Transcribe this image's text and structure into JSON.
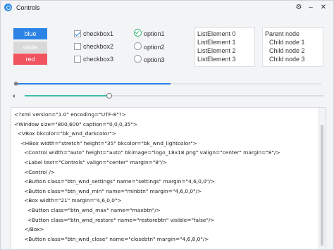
{
  "window": {
    "title": "Controls",
    "settings_icon": "gear-icon",
    "minimize_icon": "minimize-icon",
    "close_icon": "close-icon"
  },
  "buttons": [
    {
      "label": "blue",
      "color": "#2b83e6"
    },
    {
      "label": "white",
      "color": "#d9d9d9"
    },
    {
      "label": "red",
      "color": "#f0545e"
    }
  ],
  "checkboxes": [
    {
      "label": "checkbox1",
      "checked": true
    },
    {
      "label": "checkbox2",
      "checked": false
    },
    {
      "label": "checkbox3",
      "checked": false
    }
  ],
  "radios": [
    {
      "label": "option1",
      "selected": true
    },
    {
      "label": "option2",
      "selected": false
    },
    {
      "label": "option3",
      "selected": false
    }
  ],
  "list": {
    "items": [
      "ListElement 0",
      "ListElement 1",
      "ListElement 2",
      "ListElement 3"
    ]
  },
  "tree": {
    "parent": "Parent node",
    "children": [
      "Child node 1",
      "Child node 2",
      "Child node 3"
    ]
  },
  "progress": {
    "value": 0.51,
    "icon": "spinner-icon"
  },
  "slider": {
    "value": 0.28,
    "icon": "volume-icon"
  },
  "editor": {
    "lines": [
      "<?xml version=\"1.0\" encoding=\"UTF-8\"?>",
      "<Window size=\"800,600\" caption=\"0,0,0,35\">",
      "  <VBox bkcolor=\"bk_wnd_darkcolor\">",
      "    <HBox width=\"stretch\" height=\"35\" bkcolor=\"bk_wnd_lightcolor\">",
      "      <Control width=\"auto\" height=\"auto\" bkimage=\"logo_18x18.png\" valign=\"center\" margin=\"8\"/>",
      "      <Label text=\"Controls\" valign=\"center\" margin=\"8\"/>",
      "      <Control />",
      "      <Button class=\"btn_wnd_settings\" name=\"settings\" margin=\"4,6,0,0\"/>",
      "      <Button class=\"btn_wnd_min\" name=\"minbtn\" margin=\"4,6,0,0\"/>",
      "      <Box width=\"21\" margin=\"4,6,0,0\">",
      "        <Button class=\"btn_wnd_max\" name=\"maxbtn\"/>",
      "        <Button class=\"btn_wnd_restore\" name=\"restorebtn\" visible=\"false\"/>",
      "      </Box>",
      "      <Button class=\"btn_wnd_close\" name=\"closebtn\" margin=\"4,6,8,0\"/>"
    ]
  }
}
